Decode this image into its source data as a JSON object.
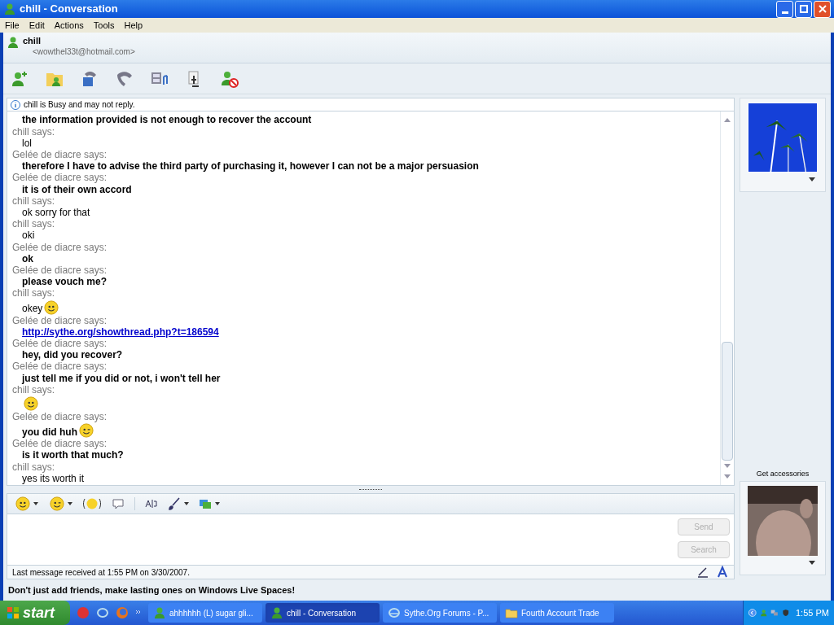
{
  "window": {
    "title": "chill - Conversation"
  },
  "menu": [
    "File",
    "Edit",
    "Actions",
    "Tools",
    "Help"
  ],
  "contact": {
    "name": "chill",
    "email": "<wowthel33t@hotmail.com>"
  },
  "status_notice": "chill is Busy and may not reply.",
  "messages": [
    {
      "text": "the information provided is not enough to recover the account",
      "bold": true,
      "kind": "text"
    },
    {
      "sender": "chill says:",
      "text": "lol",
      "bold": false,
      "kind": "text"
    },
    {
      "sender": "Gelée de diacre says:",
      "text": "therefore I have to advise the third party of purchasing it, however I can not be a major persuasion",
      "bold": true,
      "kind": "text"
    },
    {
      "sender": "Gelée de diacre says:",
      "text": "it is of their own accord",
      "bold": true,
      "kind": "text"
    },
    {
      "sender": "chill says:",
      "text": "ok sorry for that",
      "bold": false,
      "kind": "text"
    },
    {
      "sender": "chill says:",
      "text": "oki",
      "bold": false,
      "kind": "text"
    },
    {
      "sender": "Gelée de diacre says:",
      "text": "ok",
      "bold": true,
      "kind": "text"
    },
    {
      "sender": "Gelée de diacre says:",
      "text": "please vouch me?",
      "bold": true,
      "kind": "text"
    },
    {
      "sender": "chill says:",
      "text": "okey",
      "bold": false,
      "kind": "text_smiley"
    },
    {
      "sender": "Gelée de diacre says:",
      "text": "http://sythe.org/showthread.php?t=186594",
      "bold": true,
      "kind": "link"
    },
    {
      "sender": "Gelée de diacre says:",
      "text": "hey, did you recover?",
      "bold": true,
      "kind": "text"
    },
    {
      "sender": "Gelée de diacre says:",
      "text": "just tell me if you did or not, i won't tell her",
      "bold": true,
      "kind": "text"
    },
    {
      "sender": "chill says:",
      "kind": "smiley"
    },
    {
      "sender": "Gelée de diacre says:",
      "text": "you did huh",
      "bold": true,
      "kind": "text_wink"
    },
    {
      "sender": "Gelée de diacre says:",
      "text": "is it worth that much?",
      "bold": true,
      "kind": "text"
    },
    {
      "sender": "chill says:",
      "text": "yes its worth it",
      "bold": false,
      "kind": "text"
    }
  ],
  "buttons": [
    {
      "label": "Send",
      "disabled": true
    },
    {
      "label": "Search",
      "disabled": true
    }
  ],
  "status_bar": "Last message received at 1:55 PM on 3/30/2007.",
  "accessories_label": "Get accessories",
  "ad": "Don't just add friends, make lasting ones on Windows Live Spaces!",
  "taskbar": {
    "start": "start",
    "tasks": [
      {
        "label": "ahhhhhh (L) sugar gli...",
        "selected": false
      },
      {
        "label": "chill - Conversation",
        "selected": true
      },
      {
        "label": "Sythe.Org Forums - P...",
        "selected": false
      },
      {
        "label": "Fourth Account Trade",
        "selected": false
      }
    ],
    "clock": "1:55 PM"
  }
}
